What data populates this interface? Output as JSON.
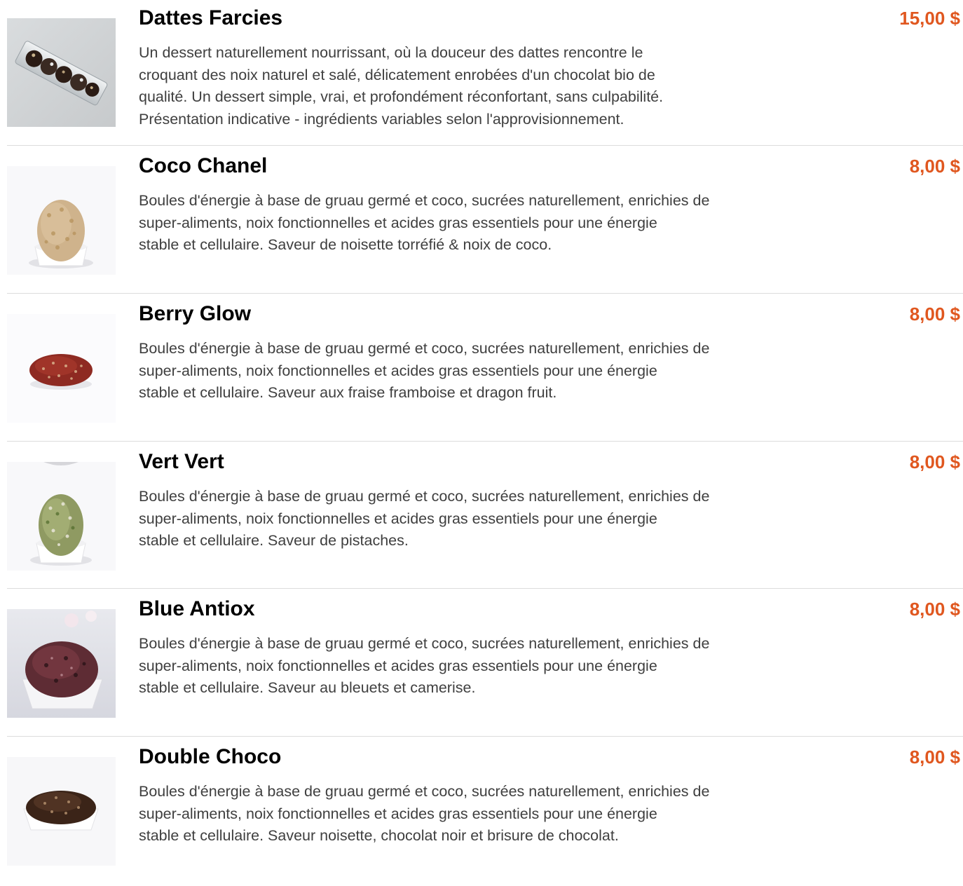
{
  "colors": {
    "price": "#e0571f",
    "title": "#000000",
    "description": "#3f3f3f",
    "divider": "#dcdcdc"
  },
  "items": [
    {
      "title": "Dattes Farcies",
      "price": "15,00 $",
      "description": "Un dessert naturellement nourrissant, où la douceur des dattes rencontre le\ncroquant des noix naturel et salé, délicatement enrobées d'un chocolat bio de\nqualité. Un dessert simple, vrai, et profondément réconfortant, sans culpabilité.\nPrésentation indicative - ingrédients variables selon l'approvisionnement.",
      "image": "stuffed-dates-box-photo"
    },
    {
      "title": "Coco Chanel",
      "price": "8,00 $",
      "description": "Boules d'énergie à base de gruau germé et coco, sucrées naturellement, enrichies de\nsuper-aliments, noix fonctionnelles et acides gras essentiels pour une énergie\nstable et cellulaire. Saveur de noisette torréfié & noix de coco.",
      "image": "energy-ball-coconut-photo"
    },
    {
      "title": "Berry Glow",
      "price": "8,00 $",
      "description": "Boules d'énergie à base de gruau germé et coco, sucrées naturellement, enrichies de\nsuper-aliments, noix fonctionnelles et acides gras essentiels pour une énergie\nstable et cellulaire. Saveur aux fraise framboise et dragon fruit.",
      "image": "energy-ball-berry-photo"
    },
    {
      "title": "Vert Vert",
      "price": "8,00 $",
      "description": "Boules d'énergie à base de gruau germé et coco, sucrées naturellement, enrichies de\nsuper-aliments, noix fonctionnelles et acides gras essentiels pour une énergie\nstable et cellulaire. Saveur de pistaches.",
      "image": "energy-ball-pistachio-photo"
    },
    {
      "title": "Blue Antiox",
      "price": "8,00 $",
      "description": "Boules d'énergie à base de gruau germé et coco, sucrées naturellement, enrichies de\nsuper-aliments, noix fonctionnelles et acides gras essentiels pour une énergie\nstable et cellulaire. Saveur au bleuets et camerise.",
      "image": "energy-ball-blueberry-photo"
    },
    {
      "title": "Double Choco",
      "price": "8,00 $",
      "description": "Boules d'énergie à base de gruau germé et coco, sucrées naturellement, enrichies de\nsuper-aliments, noix fonctionnelles et acides gras essentiels pour une énergie\nstable et cellulaire. Saveur noisette, chocolat noir et brisure de chocolat.",
      "image": "energy-ball-chocolate-photo"
    }
  ]
}
